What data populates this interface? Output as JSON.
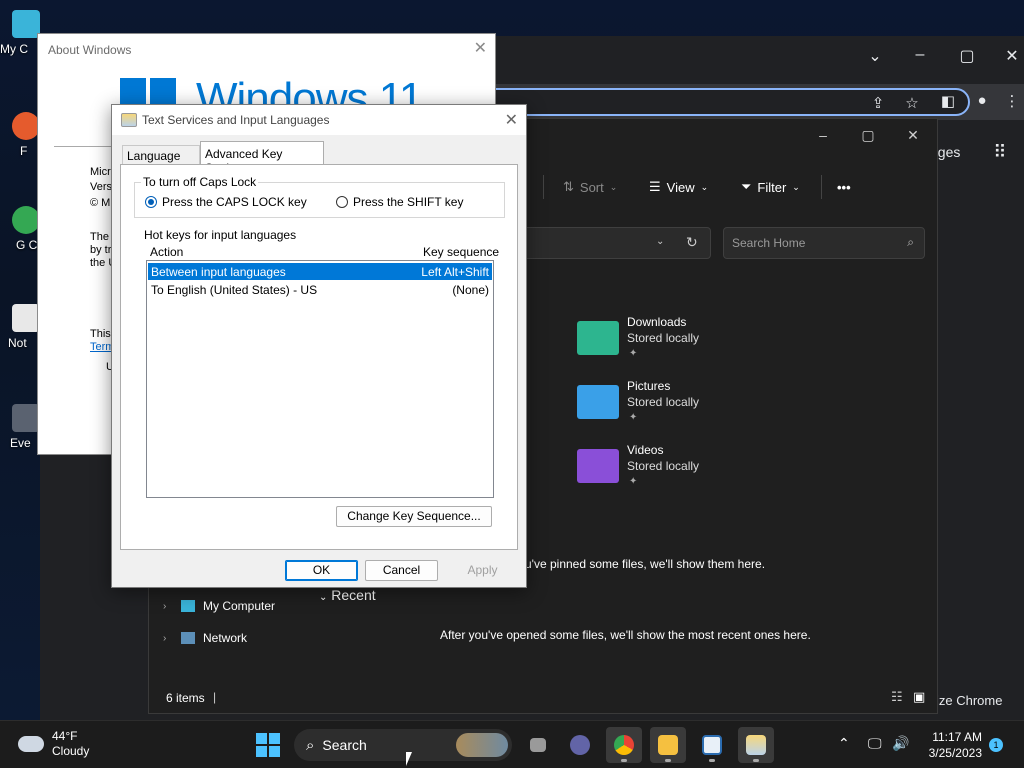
{
  "desktop": {
    "icons": [
      "My C",
      "F",
      "G Ch",
      "Not",
      "Eve"
    ]
  },
  "chrome": {
    "side_text": "ages",
    "customize": "ize Chrome"
  },
  "explorer": {
    "commands": {
      "sort": "Sort",
      "view": "View",
      "filter": "Filter",
      "more": "•••"
    },
    "search_placeholder": "Search Home",
    "folders": [
      {
        "name": "Downloads",
        "sub": "Stored locally",
        "color": "#2db58f"
      },
      {
        "name": "Pictures",
        "sub": "Stored locally",
        "color": "#3aa0e8"
      },
      {
        "name": "Videos",
        "sub": "Stored locally",
        "color": "#8a4fd8"
      }
    ],
    "pinned_msg": "u've pinned some files, we'll show them here.",
    "recent_label": "Recent",
    "recent_msg": "After you've opened some files, we'll show the most recent ones here.",
    "nav": {
      "my_computer": "My Computer",
      "network": "Network"
    },
    "status": "6 items"
  },
  "about": {
    "title": "About Windows",
    "logo_text": "Windows 11",
    "lines": [
      "Micro",
      "Vers",
      "© M",
      "The",
      "by tr",
      "the U",
      "This",
      "Term",
      "U"
    ]
  },
  "tsd": {
    "title": "Text Services and Input Languages",
    "tabs": {
      "language_bar": "Language Bar",
      "advanced": "Advanced Key Settings"
    },
    "caps_group": "To turn off Caps Lock",
    "radio_caps": "Press the CAPS LOCK key",
    "radio_shift": "Press the SHIFT key",
    "hotkeys_group": "Hot keys for input languages",
    "col_action": "Action",
    "col_seq": "Key sequence",
    "rows": [
      {
        "action": "Between input languages",
        "seq": "Left Alt+Shift"
      },
      {
        "action": "To English (United States) - US",
        "seq": "(None)"
      }
    ],
    "change_btn": "Change Key Sequence...",
    "ok": "OK",
    "cancel": "Cancel",
    "apply": "Apply"
  },
  "taskbar": {
    "temp": "44°F",
    "condition": "Cloudy",
    "search": "Search",
    "time": "11:17 AM",
    "date": "3/25/2023",
    "notif_count": "1"
  }
}
